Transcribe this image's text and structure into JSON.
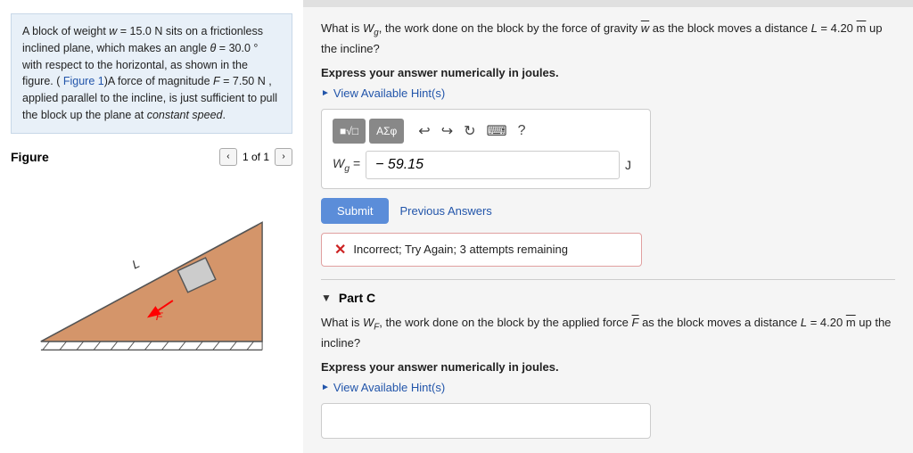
{
  "leftPanel": {
    "problemText": "A block of weight w = 15.0 N sits on a frictionless inclined plane, which makes an angle θ = 30.0 ° with respect to the horizontal, as shown in the figure. ( Figure 1)A force of magnitude F = 7.50 N , applied parallel to the incline, is just sufficient to pull the block up the plane at constant speed.",
    "figureLabel": "Figure",
    "figureNav": "1 of 1"
  },
  "rightPanel": {
    "partB": {
      "questionLine1": "What is W",
      "questionSub": "g",
      "questionLine2": ", the work done on the block by the force of gravity",
      "questionVec": "w",
      "questionLine3": "as the block moves a distance L = 4.20 m up the incline?",
      "expressLabel": "Express your answer numerically in joules.",
      "hintText": "View Available Hint(s)",
      "inputLabel": "W",
      "inputSub": "g",
      "inputEquals": "=",
      "inputValue": "− 59.15",
      "unitLabel": "J",
      "submitLabel": "Submit",
      "previousAnswersLabel": "Previous Answers"
    },
    "errorBox": {
      "text": "Incorrect; Try Again; 3 attempts remaining"
    },
    "partC": {
      "title": "Part C",
      "questionLine1": "What is W",
      "questionSub": "F",
      "questionLine2": ", the work done on the block by the applied force",
      "questionVec": "F",
      "questionLine3": "as the block moves a distance L = 4.20 m up the incline?",
      "expressLabel": "Express your answer numerically in joules.",
      "hintText": "View Available Hint(s)"
    },
    "toolbar": {
      "sqrtBtn": "√□",
      "sigmaBtn": "ΑΣφ",
      "undoIcon": "↩",
      "redoIcon": "↪",
      "refreshIcon": "↻",
      "keyboardIcon": "⌨",
      "helpIcon": "?"
    }
  }
}
